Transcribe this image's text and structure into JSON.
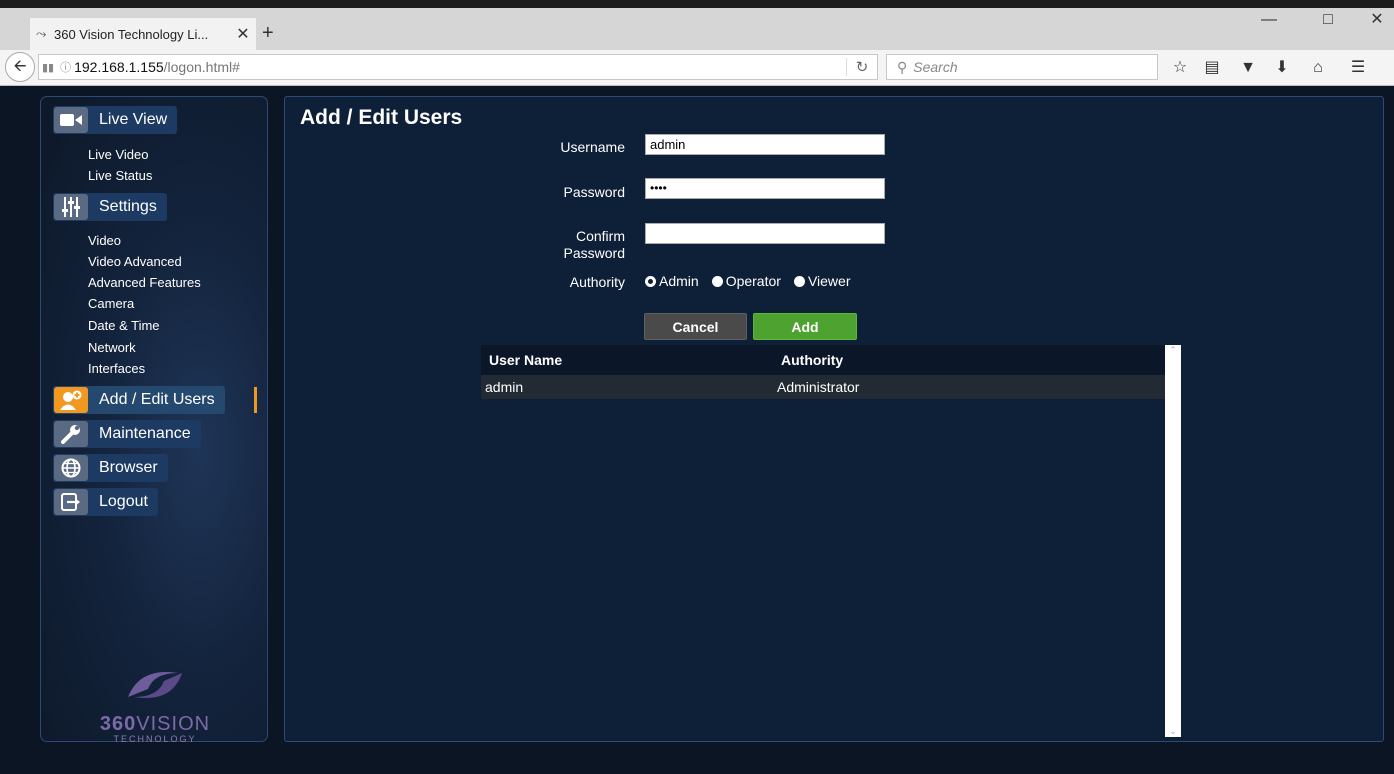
{
  "browser": {
    "tab_title": "360 Vision Technology Li...",
    "url_host": "192.168.1.155",
    "url_path": "/logon.html#",
    "search_placeholder": "Search"
  },
  "sidebar": {
    "live_view": "Live View",
    "live_view_items": [
      "Live Video",
      "Live Status"
    ],
    "settings": "Settings",
    "settings_items": [
      "Video",
      "Video Advanced",
      "Advanced Features",
      "Camera",
      "Date & Time",
      "Network",
      "Interfaces"
    ],
    "add_edit_users": "Add / Edit Users",
    "maintenance": "Maintenance",
    "browser": "Browser",
    "logout": "Logout",
    "brand": {
      "bold": "360",
      "thin": "VISION",
      "sub": "TECHNOLOGY"
    }
  },
  "main": {
    "title": "Add / Edit Users",
    "form": {
      "username_label": "Username",
      "username_value": "admin",
      "password_label": "Password",
      "password_value": "••••",
      "confirm_label_1": "Confirm",
      "confirm_label_2": "Password",
      "confirm_value": "",
      "authority_label": "Authority",
      "authority_options": [
        "Admin",
        "Operator",
        "Viewer"
      ],
      "authority_selected": "Admin"
    },
    "buttons": {
      "cancel": "Cancel",
      "add": "Add"
    },
    "table": {
      "headers": [
        "User Name",
        "Authority"
      ],
      "rows": [
        {
          "user_name": "admin",
          "authority": "Administrator"
        }
      ]
    }
  },
  "colors": {
    "accent_orange": "#f19821",
    "add_green": "#4ea22f",
    "panel_bg": "#0e1f38"
  }
}
